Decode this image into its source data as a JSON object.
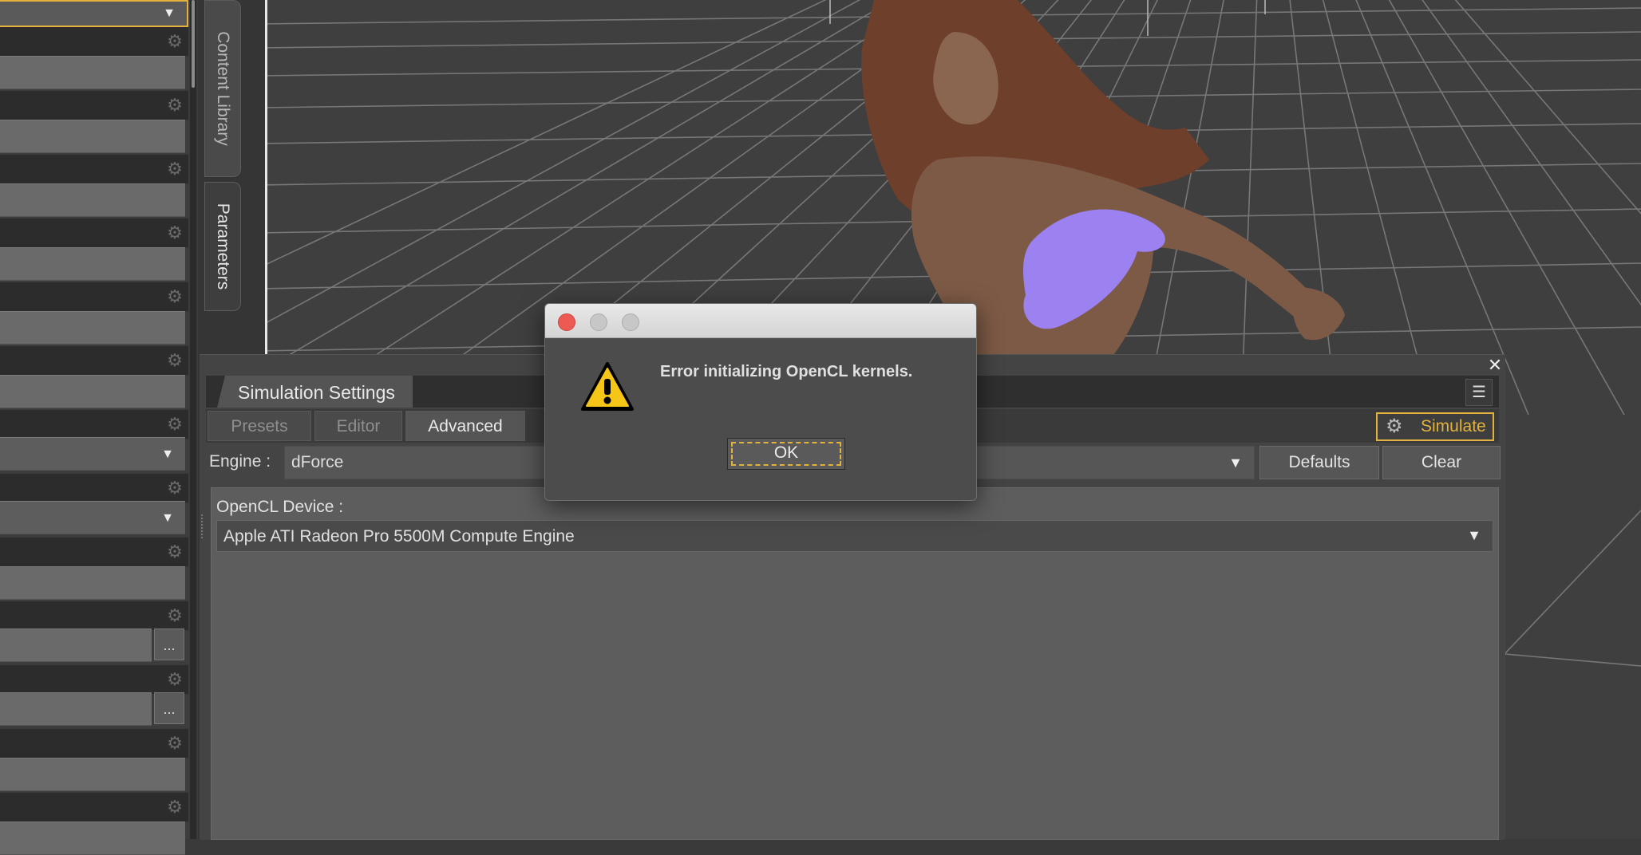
{
  "left_panel": {
    "ellipsis_label": "..."
  },
  "side_tabs": [
    {
      "label": "Content Library"
    },
    {
      "label": "Parameters"
    }
  ],
  "simulation_settings": {
    "title": "Simulation Settings",
    "tabs": [
      {
        "label": "Presets",
        "active": false
      },
      {
        "label": "Editor",
        "active": false
      },
      {
        "label": "Advanced",
        "active": true
      }
    ],
    "simulate_label": "Simulate",
    "engine_label": "Engine :",
    "engine_value": "dForce",
    "defaults_label": "Defaults",
    "clear_label": "Clear",
    "opencl_label": "OpenCL Device :",
    "opencl_value": "Apple ATI Radeon Pro 5500M Compute Engine"
  },
  "dialog": {
    "message": "Error initializing OpenCL kernels.",
    "ok_label": "OK",
    "icon": "warning-icon"
  },
  "colors": {
    "accent": "#e3b23c",
    "close_red": "#ed5a53",
    "viewport_bg": "#3f3f3f",
    "figure_hair": "#6e3f2a",
    "figure_skin": "#7d5a46",
    "censor_blob": "#9b82f0"
  }
}
